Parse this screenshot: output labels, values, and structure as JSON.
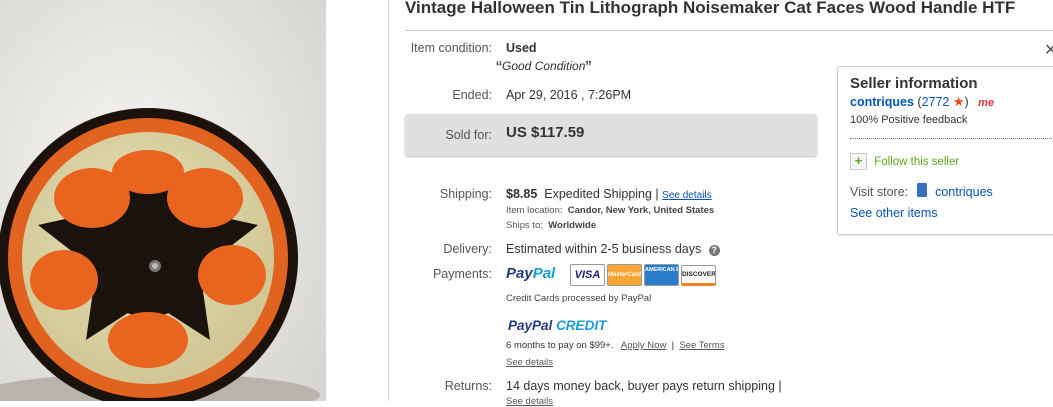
{
  "item": {
    "title": "Vintage Halloween Tin Lithograph Noisemaker Cat Faces Wood Handle HTF"
  },
  "condition": {
    "label": "Item condition:",
    "value": "Used",
    "quote_open": "“",
    "note": "Good Condition",
    "quote_close": "”"
  },
  "ended": {
    "label": "Ended:",
    "value": "Apr 29, 2016 , 7:26PM"
  },
  "sold": {
    "label": "Sold for:",
    "value": "US $117.59"
  },
  "shipping": {
    "label": "Shipping:",
    "cost": "$8.85",
    "method": "Expedited Shipping |",
    "details_link": "See details",
    "location_label": "Item location:",
    "location": "Candor, New York, United States",
    "ships_to_label": "Ships to:",
    "ships_to": "Worldwide"
  },
  "delivery": {
    "label": "Delivery:",
    "value": "Estimated within 2-5 business days",
    "help_icon": "?"
  },
  "payments": {
    "label": "Payments:",
    "paypal_a": "Pay",
    "paypal_b": "Pal",
    "cards": [
      "VISA",
      "MasterCard",
      "AMERICAN EXPRESS",
      "DISCOVER"
    ],
    "note": "Credit Cards processed by PayPal",
    "credit_a": "PayPal",
    "credit_b": "CREDIT",
    "credit_terms": "6 months to pay on $99+.",
    "apply_link": "Apply Now",
    "sep": "|",
    "terms_link": "See Terms",
    "see_details": "See details"
  },
  "returns": {
    "label": "Returns:",
    "value": "14 days money back, buyer pays return shipping |",
    "cut_text": "See details"
  },
  "seller": {
    "heading": "Seller information",
    "name": "contriques",
    "score_open": "(",
    "score": "2772",
    "score_close": ")",
    "me_badge": "me",
    "feedback": "100% Positive feedback",
    "follow": "Follow this seller",
    "visit_store_label": "Visit store:",
    "store_name": "contriques",
    "see_other": "See other items"
  },
  "colors": {
    "link": "#0654ba",
    "star": "#e8491d",
    "follow_green": "#5ba71b",
    "sold_bg": "#e0e0e0"
  }
}
